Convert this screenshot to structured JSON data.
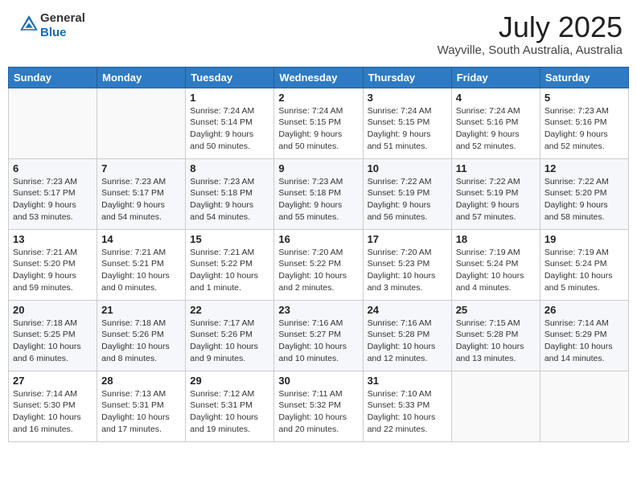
{
  "logo": {
    "general": "General",
    "blue": "Blue"
  },
  "title": "July 2025",
  "subtitle": "Wayville, South Australia, Australia",
  "days_of_week": [
    "Sunday",
    "Monday",
    "Tuesday",
    "Wednesday",
    "Thursday",
    "Friday",
    "Saturday"
  ],
  "weeks": [
    [
      {
        "day": "",
        "info": ""
      },
      {
        "day": "",
        "info": ""
      },
      {
        "day": "1",
        "info": "Sunrise: 7:24 AM\nSunset: 5:14 PM\nDaylight: 9 hours and 50 minutes."
      },
      {
        "day": "2",
        "info": "Sunrise: 7:24 AM\nSunset: 5:15 PM\nDaylight: 9 hours and 50 minutes."
      },
      {
        "day": "3",
        "info": "Sunrise: 7:24 AM\nSunset: 5:15 PM\nDaylight: 9 hours and 51 minutes."
      },
      {
        "day": "4",
        "info": "Sunrise: 7:24 AM\nSunset: 5:16 PM\nDaylight: 9 hours and 52 minutes."
      },
      {
        "day": "5",
        "info": "Sunrise: 7:23 AM\nSunset: 5:16 PM\nDaylight: 9 hours and 52 minutes."
      }
    ],
    [
      {
        "day": "6",
        "info": "Sunrise: 7:23 AM\nSunset: 5:17 PM\nDaylight: 9 hours and 53 minutes."
      },
      {
        "day": "7",
        "info": "Sunrise: 7:23 AM\nSunset: 5:17 PM\nDaylight: 9 hours and 54 minutes."
      },
      {
        "day": "8",
        "info": "Sunrise: 7:23 AM\nSunset: 5:18 PM\nDaylight: 9 hours and 54 minutes."
      },
      {
        "day": "9",
        "info": "Sunrise: 7:23 AM\nSunset: 5:18 PM\nDaylight: 9 hours and 55 minutes."
      },
      {
        "day": "10",
        "info": "Sunrise: 7:22 AM\nSunset: 5:19 PM\nDaylight: 9 hours and 56 minutes."
      },
      {
        "day": "11",
        "info": "Sunrise: 7:22 AM\nSunset: 5:19 PM\nDaylight: 9 hours and 57 minutes."
      },
      {
        "day": "12",
        "info": "Sunrise: 7:22 AM\nSunset: 5:20 PM\nDaylight: 9 hours and 58 minutes."
      }
    ],
    [
      {
        "day": "13",
        "info": "Sunrise: 7:21 AM\nSunset: 5:20 PM\nDaylight: 9 hours and 59 minutes."
      },
      {
        "day": "14",
        "info": "Sunrise: 7:21 AM\nSunset: 5:21 PM\nDaylight: 10 hours and 0 minutes."
      },
      {
        "day": "15",
        "info": "Sunrise: 7:21 AM\nSunset: 5:22 PM\nDaylight: 10 hours and 1 minute."
      },
      {
        "day": "16",
        "info": "Sunrise: 7:20 AM\nSunset: 5:22 PM\nDaylight: 10 hours and 2 minutes."
      },
      {
        "day": "17",
        "info": "Sunrise: 7:20 AM\nSunset: 5:23 PM\nDaylight: 10 hours and 3 minutes."
      },
      {
        "day": "18",
        "info": "Sunrise: 7:19 AM\nSunset: 5:24 PM\nDaylight: 10 hours and 4 minutes."
      },
      {
        "day": "19",
        "info": "Sunrise: 7:19 AM\nSunset: 5:24 PM\nDaylight: 10 hours and 5 minutes."
      }
    ],
    [
      {
        "day": "20",
        "info": "Sunrise: 7:18 AM\nSunset: 5:25 PM\nDaylight: 10 hours and 6 minutes."
      },
      {
        "day": "21",
        "info": "Sunrise: 7:18 AM\nSunset: 5:26 PM\nDaylight: 10 hours and 8 minutes."
      },
      {
        "day": "22",
        "info": "Sunrise: 7:17 AM\nSunset: 5:26 PM\nDaylight: 10 hours and 9 minutes."
      },
      {
        "day": "23",
        "info": "Sunrise: 7:16 AM\nSunset: 5:27 PM\nDaylight: 10 hours and 10 minutes."
      },
      {
        "day": "24",
        "info": "Sunrise: 7:16 AM\nSunset: 5:28 PM\nDaylight: 10 hours and 12 minutes."
      },
      {
        "day": "25",
        "info": "Sunrise: 7:15 AM\nSunset: 5:28 PM\nDaylight: 10 hours and 13 minutes."
      },
      {
        "day": "26",
        "info": "Sunrise: 7:14 AM\nSunset: 5:29 PM\nDaylight: 10 hours and 14 minutes."
      }
    ],
    [
      {
        "day": "27",
        "info": "Sunrise: 7:14 AM\nSunset: 5:30 PM\nDaylight: 10 hours and 16 minutes."
      },
      {
        "day": "28",
        "info": "Sunrise: 7:13 AM\nSunset: 5:31 PM\nDaylight: 10 hours and 17 minutes."
      },
      {
        "day": "29",
        "info": "Sunrise: 7:12 AM\nSunset: 5:31 PM\nDaylight: 10 hours and 19 minutes."
      },
      {
        "day": "30",
        "info": "Sunrise: 7:11 AM\nSunset: 5:32 PM\nDaylight: 10 hours and 20 minutes."
      },
      {
        "day": "31",
        "info": "Sunrise: 7:10 AM\nSunset: 5:33 PM\nDaylight: 10 hours and 22 minutes."
      },
      {
        "day": "",
        "info": ""
      },
      {
        "day": "",
        "info": ""
      }
    ]
  ]
}
